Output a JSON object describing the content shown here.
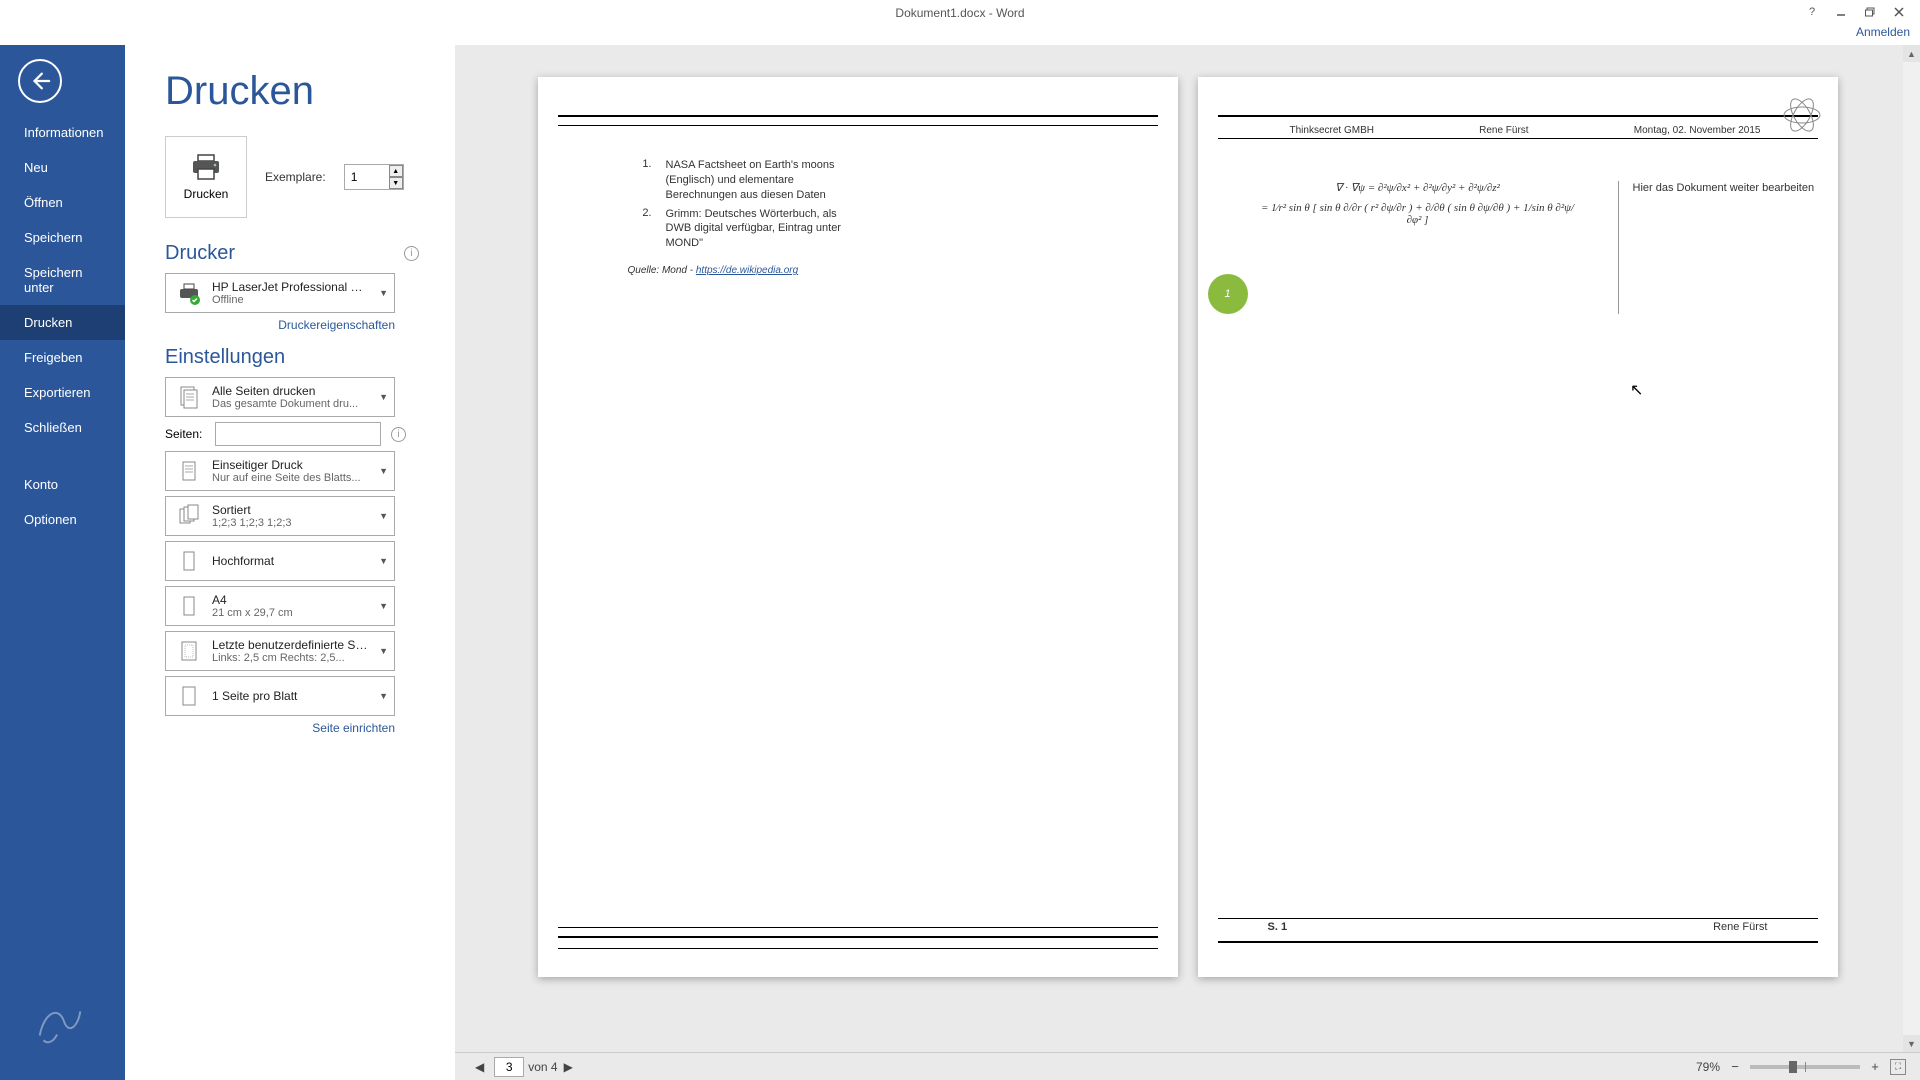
{
  "titlebar": {
    "title": "Dokument1.docx - Word"
  },
  "signin": "Anmelden",
  "sidebar": {
    "items": [
      {
        "label": "Informationen"
      },
      {
        "label": "Neu"
      },
      {
        "label": "Öffnen"
      },
      {
        "label": "Speichern"
      },
      {
        "label": "Speichern unter"
      },
      {
        "label": "Drucken"
      },
      {
        "label": "Freigeben"
      },
      {
        "label": "Exportieren"
      },
      {
        "label": "Schließen"
      }
    ],
    "bottom": [
      {
        "label": "Konto"
      },
      {
        "label": "Optionen"
      }
    ]
  },
  "page_title": "Drucken",
  "print_button": "Drucken",
  "copies": {
    "label": "Exemplare:",
    "value": "1"
  },
  "printer": {
    "section": "Drucker",
    "name": "HP LaserJet Professional CP...",
    "status": "Offline",
    "properties": "Druckereigenschaften"
  },
  "settings": {
    "section": "Einstellungen",
    "scope": {
      "t1": "Alle Seiten drucken",
      "t2": "Das gesamte Dokument dru..."
    },
    "pages_label": "Seiten:",
    "duplex": {
      "t1": "Einseitiger Druck",
      "t2": "Nur auf eine Seite des Blatts..."
    },
    "collate": {
      "t1": "Sortiert",
      "t2": "1;2;3    1;2;3    1;2;3"
    },
    "orientation": {
      "t1": "Hochformat"
    },
    "paper": {
      "t1": "A4",
      "t2": "21  cm x 29,7  cm"
    },
    "margins": {
      "t1": "Letzte benutzerdefinierte Sei...",
      "t2": "Links: 2,5  cm    Rechts: 2,5..."
    },
    "pages_per": {
      "t1": "1 Seite pro Blatt"
    },
    "page_setup": "Seite einrichten"
  },
  "preview": {
    "left_page": {
      "items": [
        {
          "n": "1.",
          "text": "NASA Factsheet on Earth's moons (Englisch) und elementare Berechnungen aus diesen Daten"
        },
        {
          "n": "2.",
          "text": "Grimm: Deutsches Wörterbuch, als DWB digital verfügbar, Eintrag unter MOND\""
        }
      ],
      "quelle_label": "Quelle: Mond - ",
      "quelle_link": "https://de.wikipedia.org"
    },
    "right_page": {
      "header": {
        "company": "Thinksecret GMBH",
        "author": "Rene Fürst",
        "date": "Montag, 02. November 2015"
      },
      "formula1": "∇ · ∇ψ = ∂²ψ/∂x² + ∂²ψ/∂y² + ∂²ψ/∂z²",
      "formula2": "= 1⁄r² sin θ [ sin θ ∂/∂r ( r² ∂ψ/∂r ) + ∂/∂θ ( sin θ ∂ψ/∂θ ) + 1/sin θ ∂²ψ/∂φ² ]",
      "note": "Hier das Dokument weiter bearbeiten",
      "badge": "1",
      "footer_page": "S. 1",
      "footer_author": "Rene Fürst"
    }
  },
  "status": {
    "page_current": "3",
    "page_total": "von 4",
    "zoom": "79%"
  }
}
